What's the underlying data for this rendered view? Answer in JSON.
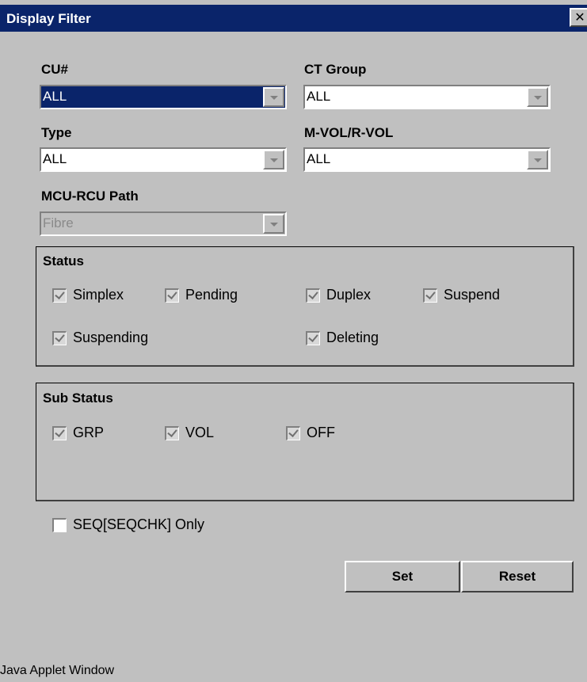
{
  "window": {
    "title": "Display Filter",
    "close": "✕"
  },
  "fields": {
    "cu": {
      "label": "CU#",
      "value": "ALL"
    },
    "ct_group": {
      "label": "CT Group",
      "value": "ALL"
    },
    "type": {
      "label": "Type",
      "value": "ALL"
    },
    "mvol_rvol": {
      "label": "M-VOL/R-VOL",
      "value": "ALL"
    },
    "mcu_rcu_path": {
      "label": "MCU-RCU Path",
      "value": "Fibre"
    }
  },
  "status": {
    "title": "Status",
    "items": [
      "Simplex",
      "Pending",
      "Duplex",
      "Suspend",
      "Suspending",
      "Deleting"
    ]
  },
  "sub_status": {
    "title": "Sub Status",
    "items": [
      "GRP",
      "VOL",
      "OFF"
    ]
  },
  "seq_only": {
    "label": "SEQ[SEQCHK] Only"
  },
  "buttons": {
    "set": "Set",
    "reset": "Reset"
  },
  "footer": "Java Applet Window"
}
